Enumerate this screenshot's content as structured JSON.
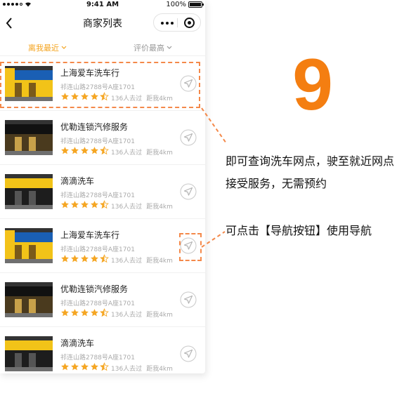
{
  "status_bar": {
    "time": "9:41 AM",
    "battery": "100%",
    "battery_level": 1.0
  },
  "nav": {
    "title": "商家列表",
    "back_icon": "back-chevron-icon",
    "more_icon": "more-dots-icon",
    "close_icon": "capsule-close-icon"
  },
  "sort": [
    {
      "label": "离我最近",
      "active": true
    },
    {
      "label": "评价最高",
      "active": false
    }
  ],
  "merchants": [
    {
      "name": "上海爱车洗车行",
      "address": "祁连山路2788号A座1701",
      "visits": "136人去过",
      "distance": "距我4km",
      "rating": 4.5
    },
    {
      "name": "优勒连锁汽修服务",
      "address": "祁连山路2788号A座1701",
      "visits": "136人去过",
      "distance": "距我4km",
      "rating": 4.5
    },
    {
      "name": "滴滴洗车",
      "address": "祁连山路2788号A座1701",
      "visits": "136人去过",
      "distance": "距我4km",
      "rating": 4.5
    },
    {
      "name": "上海爱车洗车行",
      "address": "祁连山路2788号A座1701",
      "visits": "136人去过",
      "distance": "距我4km",
      "rating": 4.5
    },
    {
      "name": "优勒连锁汽修服务",
      "address": "祁连山路2788号A座1701",
      "visits": "136人去过",
      "distance": "距我4km",
      "rating": 4.5
    },
    {
      "name": "滴滴洗车",
      "address": "祁连山路2788号A座1701",
      "visits": "136人去过",
      "distance": "距我4km",
      "rating": 4.5
    }
  ],
  "annotation": {
    "step_number": "9",
    "line1": "即可查询洗车网点，驶至就近网点接受服务，无需预约",
    "line2": "可点击【导航按钮】使用导航"
  },
  "colors": {
    "accent": "#f4a31d",
    "highlight": "#f4894a",
    "step": "#f47e11",
    "star": "#f5a623"
  }
}
